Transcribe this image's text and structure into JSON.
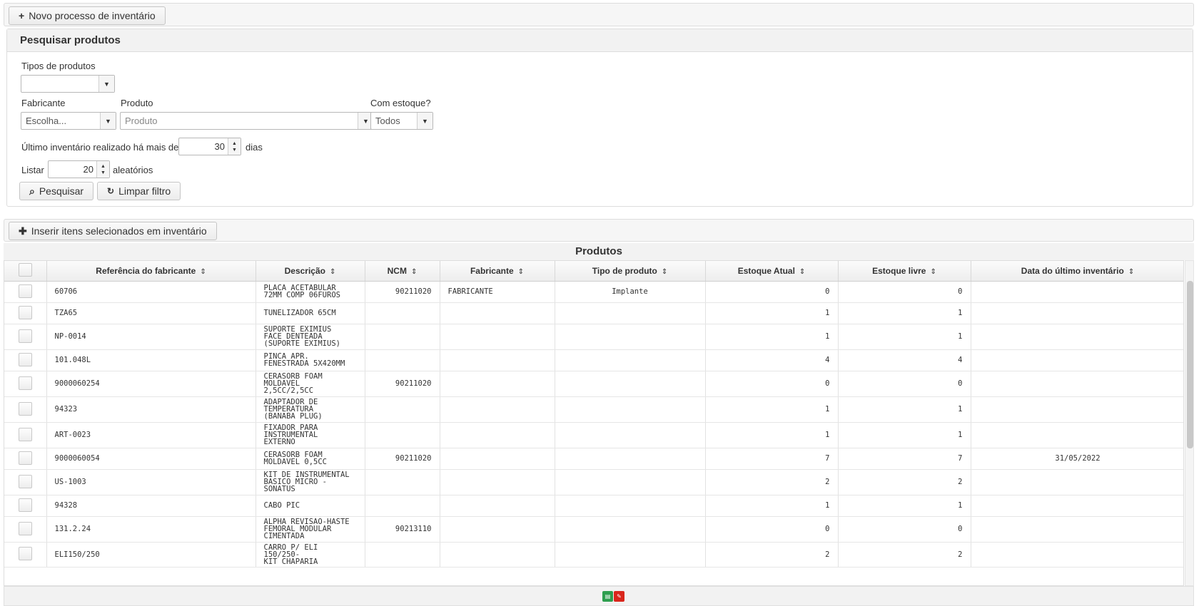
{
  "top_bar": {
    "new_process_label": "Novo processo de inventário"
  },
  "search": {
    "title": "Pesquisar produtos",
    "tipos_label": "Tipos de produtos",
    "tipos_value": "",
    "fabricante_label": "Fabricante",
    "fabricante_value": "Escolha...",
    "produto_label": "Produto",
    "produto_placeholder": "Produto",
    "estoque_label": "Com estoque?",
    "estoque_value": "Todos",
    "ultimo_label": "Último inventário realizado há mais de",
    "ultimo_value": "30",
    "dias_label": "dias",
    "listar_label": "Listar",
    "listar_value": "20",
    "aleatorios_label": "aleatórios",
    "search_button": "Pesquisar",
    "clear_button": "Limpar filtro"
  },
  "insert_bar": {
    "insert_label": "Inserir itens selecionados em inventário"
  },
  "table": {
    "title": "Produtos",
    "columns": [
      "Referência do fabricante",
      "Descrição",
      "NCM",
      "Fabricante",
      "Tipo de produto",
      "Estoque Atual",
      "Estoque livre",
      "Data do último inventário"
    ],
    "rows": [
      {
        "ref": "60706",
        "desc": [
          "PLACA ACETABULAR",
          "72MM COMP 06FUROS"
        ],
        "ncm": "90211020",
        "fab": "FABRICANTE",
        "tipo": "Implante",
        "atual": "0",
        "livre": "0",
        "data": ""
      },
      {
        "ref": "TZA65",
        "desc": [
          "TUNELIZADOR 65CM"
        ],
        "ncm": "",
        "fab": "",
        "tipo": "",
        "atual": "1",
        "livre": "1",
        "data": ""
      },
      {
        "ref": "NP-0014",
        "desc": [
          "SUPORTE EXIMIUS",
          "FACE DENTEADA",
          "(SUPORTE EXIMIUS)"
        ],
        "ncm": "",
        "fab": "",
        "tipo": "",
        "atual": "1",
        "livre": "1",
        "data": ""
      },
      {
        "ref": "101.048L",
        "desc": [
          "PINCA APR.",
          "FENESTRADA 5X420MM"
        ],
        "ncm": "",
        "fab": "",
        "tipo": "",
        "atual": "4",
        "livre": "4",
        "data": ""
      },
      {
        "ref": "9000060254",
        "desc": [
          "CERASORB FOAM",
          "MOLDAVEL",
          "2,5CC/2,5CC"
        ],
        "ncm": "90211020",
        "fab": "",
        "tipo": "",
        "atual": "0",
        "livre": "0",
        "data": ""
      },
      {
        "ref": "94323",
        "desc": [
          "ADAPTADOR DE",
          "TEMPERATURA",
          "(BANABA PLUG)"
        ],
        "ncm": "",
        "fab": "",
        "tipo": "",
        "atual": "1",
        "livre": "1",
        "data": ""
      },
      {
        "ref": "ART-0023",
        "desc": [
          "FIXADOR PARA",
          "INSTRUMENTAL",
          "EXTERNO"
        ],
        "ncm": "",
        "fab": "",
        "tipo": "",
        "atual": "1",
        "livre": "1",
        "data": ""
      },
      {
        "ref": "9000060054",
        "desc": [
          "CERASORB FOAM",
          "MOLDAVEL 0,5CC"
        ],
        "ncm": "90211020",
        "fab": "",
        "tipo": "",
        "atual": "7",
        "livre": "7",
        "data": "31/05/2022"
      },
      {
        "ref": "US-1003",
        "desc": [
          "KIT DE INSTRUMENTAL",
          "BASICO MICRO -",
          "SONATUS"
        ],
        "ncm": "",
        "fab": "",
        "tipo": "",
        "atual": "2",
        "livre": "2",
        "data": ""
      },
      {
        "ref": "94328",
        "desc": [
          "CABO PIC"
        ],
        "ncm": "",
        "fab": "",
        "tipo": "",
        "atual": "1",
        "livre": "1",
        "data": ""
      },
      {
        "ref": "131.2.24",
        "desc": [
          "ALPHA REVISAO-HASTE",
          "FEMORAL MODULAR",
          "CIMENTADA"
        ],
        "ncm": "90213110",
        "fab": "",
        "tipo": "",
        "atual": "0",
        "livre": "0",
        "data": ""
      },
      {
        "ref": "ELI150/250",
        "desc": [
          "CARRO P/ ELI 150/250-",
          "KIT CHAPARIA"
        ],
        "ncm": "",
        "fab": "",
        "tipo": "",
        "atual": "2",
        "livre": "2",
        "data": ""
      }
    ]
  },
  "footer": {
    "excel_icon_color": "#2e9e4f",
    "pdf_icon_color": "#d9261c"
  },
  "colors": {
    "panel_bg": "#f2f2f2",
    "border": "#dddddd"
  }
}
